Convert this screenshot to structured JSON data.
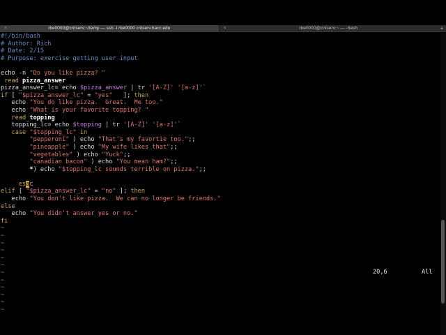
{
  "tabs": [
    {
      "label": "rbe0000@cntserv:~/temp — ssh -l rbe0000 cntserv.hacc.edu",
      "active": true
    },
    {
      "label": "rbe0000@cntserv:~ — -bash",
      "active": false
    }
  ],
  "editor": {
    "lines": [
      [
        [
          "cmt",
          "#!/bin/bash"
        ]
      ],
      [
        [
          "cmt",
          "# Author: Rich"
        ]
      ],
      [
        [
          "cmt",
          "# Date: 2/15"
        ]
      ],
      [
        [
          "cmt",
          "# Purpose: exercise getting user input"
        ]
      ],
      [],
      [
        [
          "cmd",
          "echo -n "
        ],
        [
          "str",
          "\"Do you like pizza? \""
        ]
      ],
      [
        [
          "kw",
          " read "
        ],
        [
          "bold",
          "pizza_answer"
        ]
      ],
      [
        [
          "cmd",
          "pizza_answer_lc="
        ],
        [
          "str",
          "`"
        ],
        [
          "cmd",
          "echo "
        ],
        [
          "var",
          "$pizza_answer"
        ],
        [
          "cmd",
          " | tr "
        ],
        [
          "str",
          "'[A-Z]'"
        ],
        [
          "cmd",
          " "
        ],
        [
          "str",
          "'[a-z]'"
        ],
        [
          "str",
          "`"
        ]
      ],
      [
        [
          "kw",
          "if"
        ],
        [
          "cmd",
          " [ "
        ],
        [
          "str",
          "\"$pizza_answer_lc\""
        ],
        [
          "cmd",
          " = "
        ],
        [
          "str",
          "\"yes\""
        ],
        [
          "cmd",
          "   ]; "
        ],
        [
          "kw",
          "then"
        ]
      ],
      [
        [
          "cmd",
          "   echo "
        ],
        [
          "str",
          "\"You do like pizza.  Great.  Me too.\""
        ]
      ],
      [
        [
          "cmd",
          "   echo "
        ],
        [
          "str",
          "\"What is your favorite topping? \""
        ]
      ],
      [
        [
          "kw",
          "   read "
        ],
        [
          "bold",
          "topping"
        ]
      ],
      [
        [
          "cmd",
          "   topping_lc="
        ],
        [
          "str",
          "`"
        ],
        [
          "cmd",
          "echo "
        ],
        [
          "var",
          "$topping"
        ],
        [
          "cmd",
          " | tr "
        ],
        [
          "str",
          "'[A-Z]'"
        ],
        [
          "cmd",
          " "
        ],
        [
          "str",
          "'[a-z]'"
        ],
        [
          "str",
          "`"
        ]
      ],
      [
        [
          "kw",
          "   case "
        ],
        [
          "str",
          "\"$topping_lc\""
        ],
        [
          "kw",
          " in"
        ]
      ],
      [
        [
          "str",
          "        \"pepperoni\""
        ],
        [
          "cmd",
          " ) echo "
        ],
        [
          "str",
          "\"That's my favortie too.\""
        ],
        [
          "cmd",
          ";;"
        ]
      ],
      [
        [
          "str",
          "        \"pineapple\""
        ],
        [
          "cmd",
          " ) echo "
        ],
        [
          "str",
          "\"My wife likes that\""
        ],
        [
          "cmd",
          ";;"
        ]
      ],
      [
        [
          "str",
          "        \"vegetables\""
        ],
        [
          "cmd",
          " ) echo "
        ],
        [
          "str",
          "\"Yuck\""
        ],
        [
          "cmd",
          ";;"
        ]
      ],
      [
        [
          "str",
          "        \"canadian bacon\""
        ],
        [
          "cmd",
          " ) echo "
        ],
        [
          "str",
          "\"You mean ham?\""
        ],
        [
          "cmd",
          ";;"
        ]
      ],
      [
        [
          "bold",
          "        *"
        ],
        [
          "cmd",
          ") echo "
        ],
        [
          "str",
          "\"$topping_lc sounds terrible on pizza.\""
        ],
        [
          "cmd",
          ";;"
        ]
      ],
      [],
      [
        [
          "kw",
          "     es"
        ],
        [
          "cursor",
          "a"
        ],
        [
          "kw",
          "c"
        ]
      ],
      [
        [
          "kw",
          "elif"
        ],
        [
          "cmd",
          " [ "
        ],
        [
          "str",
          "\"$pizza_answer_lc\""
        ],
        [
          "cmd",
          " = "
        ],
        [
          "str",
          "\"no\""
        ],
        [
          "cmd",
          " ]; "
        ],
        [
          "kw",
          "then"
        ]
      ],
      [
        [
          "cmd",
          "   echo "
        ],
        [
          "str",
          "\"You don't like pizza.  We can no longer be friends.\""
        ]
      ],
      [
        [
          "kw",
          "else"
        ]
      ],
      [
        [
          "cmd",
          "   echo "
        ],
        [
          "str",
          "\"You didn't answer yes or no.\""
        ]
      ],
      [
        [
          "kw",
          "fi"
        ]
      ],
      [
        [
          "tilde",
          "~"
        ]
      ],
      [
        [
          "tilde",
          "~"
        ]
      ],
      [
        [
          "tilde",
          "~"
        ]
      ],
      [
        [
          "tilde",
          "~"
        ]
      ],
      [
        [
          "tilde",
          "~"
        ]
      ],
      [
        [
          "tilde",
          "~"
        ]
      ],
      [
        [
          "tilde",
          "~"
        ]
      ],
      [
        [
          "tilde",
          "~"
        ]
      ],
      [
        [
          "tilde",
          "~"
        ]
      ],
      [
        [
          "tilde",
          "~"
        ]
      ],
      [
        [
          "tilde",
          "~"
        ]
      ],
      [
        [
          "tilde",
          "~"
        ]
      ]
    ]
  },
  "status": {
    "position": "20,6",
    "scroll": "All"
  }
}
